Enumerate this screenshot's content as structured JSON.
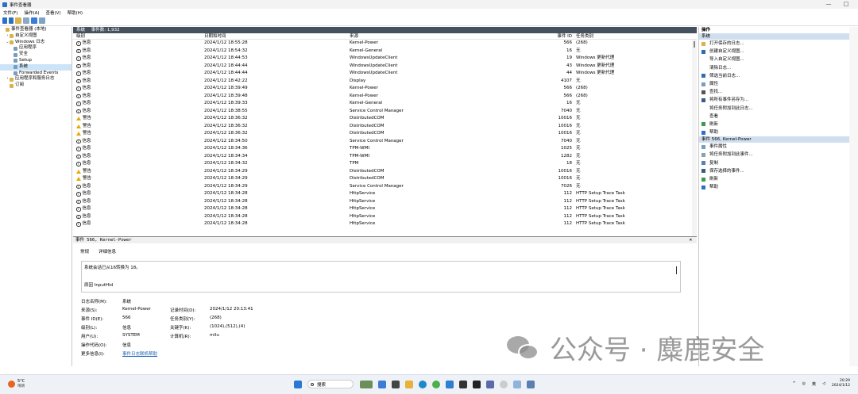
{
  "window": {
    "title": "事件查看器",
    "min": "—",
    "max": "□"
  },
  "menu": [
    "文件(F)",
    "操作(A)",
    "查看(V)",
    "帮助(H)"
  ],
  "tree": [
    {
      "label": "事件查看器 (本地)",
      "exp": "",
      "lvl": 0
    },
    {
      "label": "自定义视图",
      "exp": "›",
      "lvl": 1
    },
    {
      "label": "Windows 日志",
      "exp": "⌄",
      "lvl": 1
    },
    {
      "label": "应用程序",
      "exp": "",
      "lvl": 2
    },
    {
      "label": "安全",
      "exp": "",
      "lvl": 2
    },
    {
      "label": "Setup",
      "exp": "",
      "lvl": 2
    },
    {
      "label": "系统",
      "exp": "",
      "lvl": 2,
      "sel": true
    },
    {
      "label": "Forwarded Events",
      "exp": "",
      "lvl": 2
    },
    {
      "label": "应用程序和服务日志",
      "exp": "›",
      "lvl": 1
    },
    {
      "label": "订阅",
      "exp": "",
      "lvl": 1
    }
  ],
  "log": {
    "name": "系统",
    "count": "事件数: 1,932"
  },
  "columns": {
    "level": "级别",
    "datetime": "日期和时间",
    "source": "来源",
    "id": "事件 ID",
    "category": "任务类别"
  },
  "events": [
    {
      "level": "信息",
      "type": "info",
      "time": "2024/1/12 18:55:28",
      "source": "Kernel-Power",
      "id": "566",
      "cat": "(268)"
    },
    {
      "level": "信息",
      "type": "info",
      "time": "2024/1/12 18:54:32",
      "source": "Kernel-General",
      "id": "16",
      "cat": "无"
    },
    {
      "level": "信息",
      "type": "info",
      "time": "2024/1/12 18:44:53",
      "source": "WindowsUpdateClient",
      "id": "19",
      "cat": "Windows 更新代理"
    },
    {
      "level": "信息",
      "type": "info",
      "time": "2024/1/12 18:44:44",
      "source": "WindowsUpdateClient",
      "id": "43",
      "cat": "Windows 更新代理"
    },
    {
      "level": "信息",
      "type": "info",
      "time": "2024/1/12 18:44:44",
      "source": "WindowsUpdateClient",
      "id": "44",
      "cat": "Windows 更新代理"
    },
    {
      "level": "信息",
      "type": "info",
      "time": "2024/1/12 18:42:22",
      "source": "Display",
      "id": "4107",
      "cat": "无"
    },
    {
      "level": "信息",
      "type": "info",
      "time": "2024/1/12 18:39:49",
      "source": "Kernel-Power",
      "id": "566",
      "cat": "(268)"
    },
    {
      "level": "信息",
      "type": "info",
      "time": "2024/1/12 18:39:48",
      "source": "Kernel-Power",
      "id": "566",
      "cat": "(268)"
    },
    {
      "level": "信息",
      "type": "info",
      "time": "2024/1/12 18:39:33",
      "source": "Kernel-General",
      "id": "16",
      "cat": "无"
    },
    {
      "level": "信息",
      "type": "info",
      "time": "2024/1/12 18:38:55",
      "source": "Service Control Manager",
      "id": "7040",
      "cat": "无"
    },
    {
      "level": "警告",
      "type": "warn",
      "time": "2024/1/12 18:36:32",
      "source": "DistributedCOM",
      "id": "10016",
      "cat": "无"
    },
    {
      "level": "警告",
      "type": "warn",
      "time": "2024/1/12 18:36:32",
      "source": "DistributedCOM",
      "id": "10016",
      "cat": "无"
    },
    {
      "level": "警告",
      "type": "warn",
      "time": "2024/1/12 18:36:32",
      "source": "DistributedCOM",
      "id": "10016",
      "cat": "无"
    },
    {
      "level": "信息",
      "type": "info",
      "time": "2024/1/12 18:34:50",
      "source": "Service Control Manager",
      "id": "7040",
      "cat": "无"
    },
    {
      "level": "信息",
      "type": "info",
      "time": "2024/1/12 18:34:36",
      "source": "TPM-WMI",
      "id": "1025",
      "cat": "无"
    },
    {
      "level": "信息",
      "type": "info",
      "time": "2024/1/12 18:34:34",
      "source": "TPM-WMI",
      "id": "1282",
      "cat": "无"
    },
    {
      "level": "信息",
      "type": "info",
      "time": "2024/1/12 18:34:32",
      "source": "TPM",
      "id": "18",
      "cat": "无"
    },
    {
      "level": "警告",
      "type": "warn",
      "time": "2024/1/12 18:34:29",
      "source": "DistributedCOM",
      "id": "10016",
      "cat": "无"
    },
    {
      "level": "警告",
      "type": "warn",
      "time": "2024/1/12 18:34:29",
      "source": "DistributedCOM",
      "id": "10016",
      "cat": "无"
    },
    {
      "level": "信息",
      "type": "info",
      "time": "2024/1/12 18:34:29",
      "source": "Service Control Manager",
      "id": "7026",
      "cat": "无"
    },
    {
      "level": "信息",
      "type": "info",
      "time": "2024/1/12 18:34:28",
      "source": "HttpService",
      "id": "112",
      "cat": "HTTP Setup Trace Task"
    },
    {
      "level": "信息",
      "type": "info",
      "time": "2024/1/12 18:34:28",
      "source": "HttpService",
      "id": "112",
      "cat": "HTTP Setup Trace Task"
    },
    {
      "level": "信息",
      "type": "info",
      "time": "2024/1/12 18:34:28",
      "source": "HttpService",
      "id": "112",
      "cat": "HTTP Setup Trace Task"
    },
    {
      "level": "信息",
      "type": "info",
      "time": "2024/1/12 18:34:28",
      "source": "HttpService",
      "id": "112",
      "cat": "HTTP Setup Trace Task"
    },
    {
      "level": "信息",
      "type": "info",
      "time": "2024/1/12 18:34:28",
      "source": "HttpService",
      "id": "112",
      "cat": "HTTP Setup Trace Task"
    }
  ],
  "detail": {
    "header": "事件 566, Kernel-Power",
    "close": "×",
    "tabs": [
      "常规",
      "详细信息"
    ],
    "message": "系统会话已从16转换为 18。",
    "message2": "原因 InputHid",
    "labels": {
      "logname": "日志名称(M):",
      "source": "来源(S):",
      "eventid": "事件 ID(E):",
      "level": "级别(L):",
      "user": "用户(U):",
      "opcode": "操作代码(O):",
      "more": "更多信息(I):",
      "logged": "记录时间(D):",
      "category": "任务类别(Y):",
      "keywords": "关键字(K):",
      "computer": "计算机(R):"
    },
    "values": {
      "logname": "系统",
      "source": "Kernel-Power",
      "eventid": "566",
      "level": "信息",
      "user": "SYSTEM",
      "opcode": "信息",
      "more": "事件日志联机帮助",
      "logged": "2024/1/12 20:13:41",
      "category": "(268)",
      "keywords": "(1024),(512),(4)",
      "computer": "milu"
    }
  },
  "actions": {
    "header": "操作",
    "section1": "系统",
    "items1": [
      {
        "label": "打开保存的日志...",
        "icon": "open-log-icon"
      },
      {
        "label": "创建自定义视图...",
        "icon": "filter-icon"
      },
      {
        "label": "导入自定义视图...",
        "icon": ""
      },
      {
        "label": "清除日志...",
        "icon": ""
      },
      {
        "label": "筛选当前日志...",
        "icon": "filter-icon"
      },
      {
        "label": "属性",
        "icon": "properties-icon"
      },
      {
        "label": "查找...",
        "icon": "find-icon"
      },
      {
        "label": "将所有事件另存为...",
        "icon": "save-icon"
      },
      {
        "label": "将任务附加到此日志...",
        "icon": ""
      },
      {
        "label": "查看",
        "icon": ""
      },
      {
        "label": "刷新",
        "icon": "refresh-icon"
      },
      {
        "label": "帮助",
        "icon": "help-icon"
      }
    ],
    "section2": "事件 566, Kernel-Power",
    "items2": [
      {
        "label": "事件属性",
        "icon": "properties-icon"
      },
      {
        "label": "将任务附加到此事件...",
        "icon": "task-icon"
      },
      {
        "label": "复制",
        "icon": "copy-icon"
      },
      {
        "label": "保存选择的事件...",
        "icon": "save-icon"
      },
      {
        "label": "刷新",
        "icon": "refresh-icon"
      },
      {
        "label": "帮助",
        "icon": "help-icon"
      }
    ]
  },
  "taskbar": {
    "temp": "5°C",
    "weather": "晴朗",
    "search": "搜索",
    "lang": "英",
    "time": "20:29",
    "date": "2024/1/12"
  },
  "watermark": "公众号 · 麋鹿安全",
  "colors": {
    "header": "#45525e",
    "selection": "#cce4f7",
    "section": "#cfdfee",
    "warn": "#e8a800",
    "link": "#1a5fb4"
  }
}
